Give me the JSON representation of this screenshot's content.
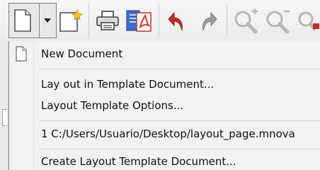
{
  "toolbar": {
    "icons": [
      "new-document-icon",
      "dropdown-arrow-icon",
      "new-template-icon",
      "print-icon",
      "export-pdf-icon",
      "undo-icon",
      "redo-icon",
      "zoom-in-icon",
      "zoom-out-icon"
    ],
    "colors": {
      "undo": "#c0302a",
      "redo": "#8a8a8a",
      "pdf": "#d23a2a",
      "zoom": "#b7b7b7"
    }
  },
  "menu": {
    "items": [
      {
        "label": "New Document",
        "icon": "document-icon"
      },
      {
        "label": "Lay out in Template Document..."
      },
      {
        "label": "Layout Template Options..."
      },
      {
        "label": "1 C:/Users/Usuario/Desktop/layout_page.mnova"
      },
      {
        "label": "Create Layout Template Document..."
      }
    ]
  }
}
